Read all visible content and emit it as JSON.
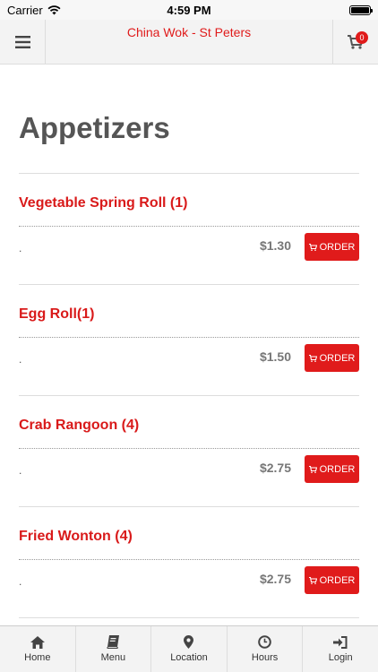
{
  "status_bar": {
    "carrier": "Carrier",
    "time": "4:59 PM"
  },
  "header": {
    "title": "China Wok - St Peters",
    "cart_count": "0"
  },
  "section": {
    "title": "Appetizers"
  },
  "items": [
    {
      "name": "Vegetable Spring Roll (1)",
      "description": ".",
      "price": "$1.30",
      "order_label": "ORDER"
    },
    {
      "name": "Egg Roll(1)",
      "description": ".",
      "price": "$1.50",
      "order_label": "ORDER"
    },
    {
      "name": "Crab Rangoon (4)",
      "description": ".",
      "price": "$2.75",
      "order_label": "ORDER"
    },
    {
      "name": "Fried Wonton (4)",
      "description": ".",
      "price": "$2.75",
      "order_label": "ORDER"
    }
  ],
  "tabs": [
    {
      "label": "Home",
      "icon": "home-icon"
    },
    {
      "label": "Menu",
      "icon": "book-icon"
    },
    {
      "label": "Location",
      "icon": "map-pin-icon"
    },
    {
      "label": "Hours",
      "icon": "clock-icon"
    },
    {
      "label": "Login",
      "icon": "login-icon"
    }
  ],
  "colors": {
    "accent": "#e01b1b",
    "header_bg": "#f3f3f3"
  }
}
